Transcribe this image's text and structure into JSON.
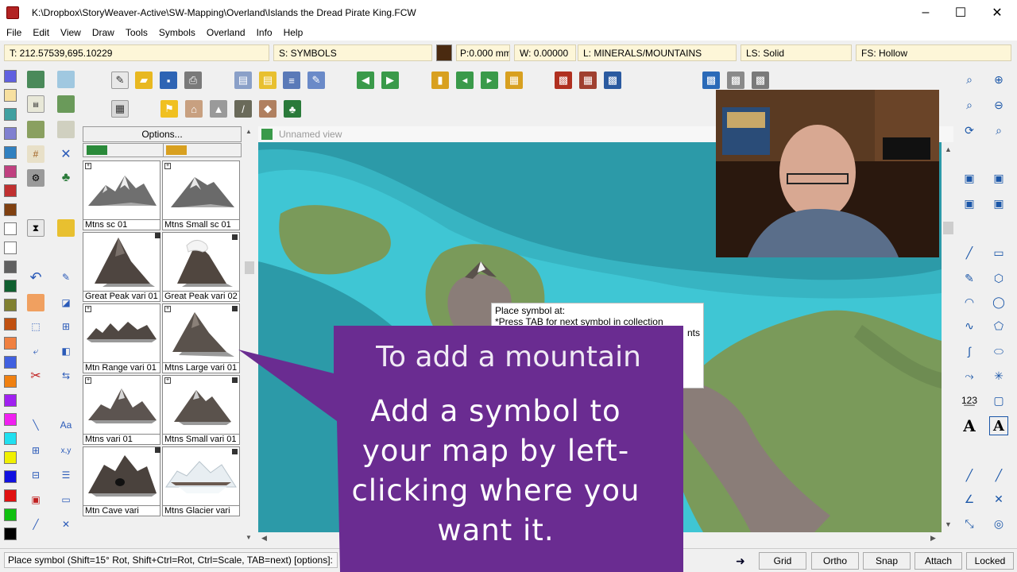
{
  "window": {
    "title": "K:\\Dropbox\\StoryWeaver-Active\\SW-Mapping\\Overland\\Islands the Dread Pirate King.FCW",
    "minimize": "–",
    "maximize": "☐",
    "close": "✕"
  },
  "menu": [
    "File",
    "Edit",
    "View",
    "Draw",
    "Tools",
    "Symbols",
    "Overland",
    "Info",
    "Help"
  ],
  "infobar": {
    "coords": "T: 212.57539,695.10229",
    "sheet": "S: SYMBOLS",
    "pen_width": "P:0.000 mm",
    "width": "W: 0.00000",
    "layer": "L: MINERALS/MOUNTAINS",
    "line_style": "LS: Solid",
    "fill_style": "FS: Hollow",
    "color_swatch": "#4a2a10"
  },
  "symbols": {
    "options_label": "Options...",
    "items": [
      {
        "label": "Mtns sc 01",
        "icon": "mountain-range-icon"
      },
      {
        "label": "Mtns Small sc 01",
        "icon": "mountain-icon"
      },
      {
        "label": "Great Peak vari 01",
        "icon": "peak-icon"
      },
      {
        "label": "Great Peak vari 02",
        "icon": "snowy-peak-icon"
      },
      {
        "label": "Mtn Range vari 01",
        "icon": "mountain-range-icon"
      },
      {
        "label": "Mtns Large vari 01",
        "icon": "peak-icon"
      },
      {
        "label": "Mtns vari 01",
        "icon": "mountain-range-icon"
      },
      {
        "label": "Mtns Small vari 01",
        "icon": "mountain-icon"
      },
      {
        "label": "Mtn Cave vari",
        "icon": "cave-icon"
      },
      {
        "label": "Mtns Glacier vari",
        "icon": "glacier-icon"
      }
    ]
  },
  "map": {
    "view_title": "Unnamed view",
    "tooltip_line1": "Place symbol at:",
    "tooltip_line2": "*Press TAB for next symbol in collection",
    "tooltip_line3": "nts",
    "colors": {
      "deep_water": "#2c9aa8",
      "shallow_water": "#3fc6d4",
      "land": "#7a9a5a",
      "rock": "#8a7d78"
    }
  },
  "callout": {
    "ghost_text": "To add a mountain",
    "text": "Add a symbol to your map by left-clicking where you want it.",
    "color": "#6a2c91"
  },
  "statusbar": {
    "prompt": "Place symbol (Shift=15° Rot, Shift+Ctrl=Rot, Ctrl=Scale, TAB=next) [options]:",
    "buttons": [
      "Grid",
      "Ortho",
      "Snap",
      "Attach",
      "Locked"
    ]
  }
}
